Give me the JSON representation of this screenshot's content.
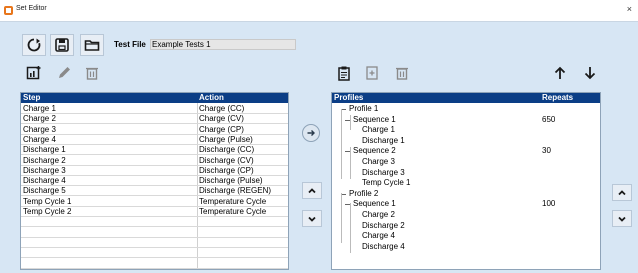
{
  "window": {
    "title": "Set Editor",
    "close_symbol": "×"
  },
  "toolbar": {
    "refresh_icon": "refresh-icon",
    "save_icon": "save-icon",
    "open_icon": "folder-open-icon",
    "test_file_label": "Test File",
    "test_file_value": "Example Tests 1"
  },
  "steps_toolbar": {
    "add_icon": "add-step-icon",
    "edit_icon": "pencil-icon",
    "delete_icon": "trash-icon"
  },
  "steps_table": {
    "columns": [
      "Step",
      "Action"
    ],
    "rows": [
      [
        "Charge 1",
        "Charge (CC)"
      ],
      [
        "Charge 2",
        "Charge (CV)"
      ],
      [
        "Charge 3",
        "Charge (CP)"
      ],
      [
        "Charge 4",
        "Charge (Pulse)"
      ],
      [
        "Discharge 1",
        "Discharge (CC)"
      ],
      [
        "Discharge 2",
        "Discharge (CV)"
      ],
      [
        "Discharge 3",
        "Discharge (CP)"
      ],
      [
        "Discharge 4",
        "Discharge (Pulse)"
      ],
      [
        "Discharge 5",
        "Discharge (REGEN)"
      ],
      [
        "Temp Cycle 1",
        "Temperature Cycle"
      ],
      [
        "Temp Cycle 2",
        "Temperature Cycle"
      ]
    ]
  },
  "profiles_toolbar": {
    "paste_icon": "clipboard-icon",
    "add_icon": "add-icon",
    "delete_icon": "trash-icon",
    "up_icon": "arrow-up-icon",
    "down_icon": "arrow-down-icon"
  },
  "profiles_tree": {
    "columns": [
      "Profiles",
      "Repeats"
    ],
    "nodes": [
      {
        "label": "Profile 1",
        "repeats": ""
      },
      {
        "label": "Sequence 1",
        "repeats": "650"
      },
      {
        "label": "Charge 1",
        "repeats": ""
      },
      {
        "label": "Discharge 1",
        "repeats": ""
      },
      {
        "label": "Sequence 2",
        "repeats": "30"
      },
      {
        "label": "Charge 3",
        "repeats": ""
      },
      {
        "label": "Discharge 3",
        "repeats": ""
      },
      {
        "label": "Temp Cycle 1",
        "repeats": ""
      },
      {
        "label": "Profile 2",
        "repeats": ""
      },
      {
        "label": "Sequence 1",
        "repeats": "100"
      },
      {
        "label": "Charge 2",
        "repeats": ""
      },
      {
        "label": "Discharge 2",
        "repeats": ""
      },
      {
        "label": "Charge 4",
        "repeats": ""
      },
      {
        "label": "Discharge 4",
        "repeats": ""
      }
    ]
  },
  "middle_buttons": {
    "move_right_icon": "arrow-right-circle-icon",
    "up_icon": "chevron-up-icon",
    "down_icon": "chevron-down-icon"
  },
  "right_buttons": {
    "up_icon": "chevron-up-icon",
    "down_icon": "chevron-down-icon"
  }
}
